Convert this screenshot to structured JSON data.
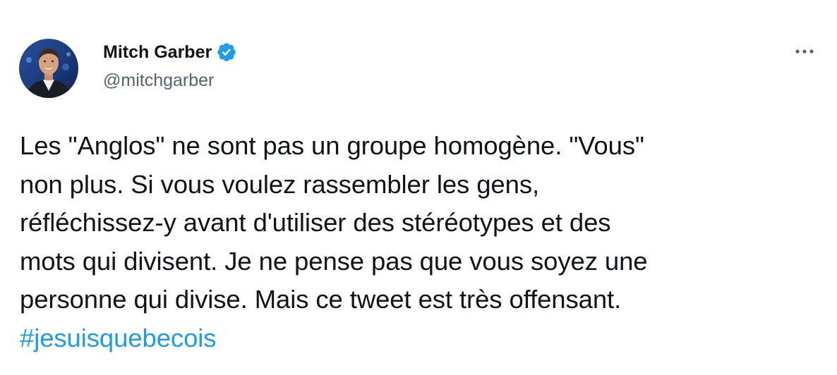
{
  "author": {
    "display_name": "Mitch Garber",
    "handle": "@mitchgarber",
    "verified": true,
    "avatar_icon": "profile-photo"
  },
  "tweet": {
    "lines": [
      "Les \"Anglos\" ne sont pas un groupe homogène. \"Vous\"",
      "non plus. Si vous voulez rassembler les gens,",
      "réfléchissez-y avant d'utiliser des stéréotypes et des",
      "mots qui divisent. Je ne pense pas que vous soyez une",
      "personne qui divise. Mais ce tweet est très offensant."
    ],
    "hashtag": "#jesuisquebecois"
  },
  "colors": {
    "text": "#0f1419",
    "secondary_text": "#536471",
    "accent": "#1d9bf0",
    "background": "#ffffff"
  },
  "icons": {
    "verified": "verified-badge-icon",
    "more": "more-options-icon"
  }
}
